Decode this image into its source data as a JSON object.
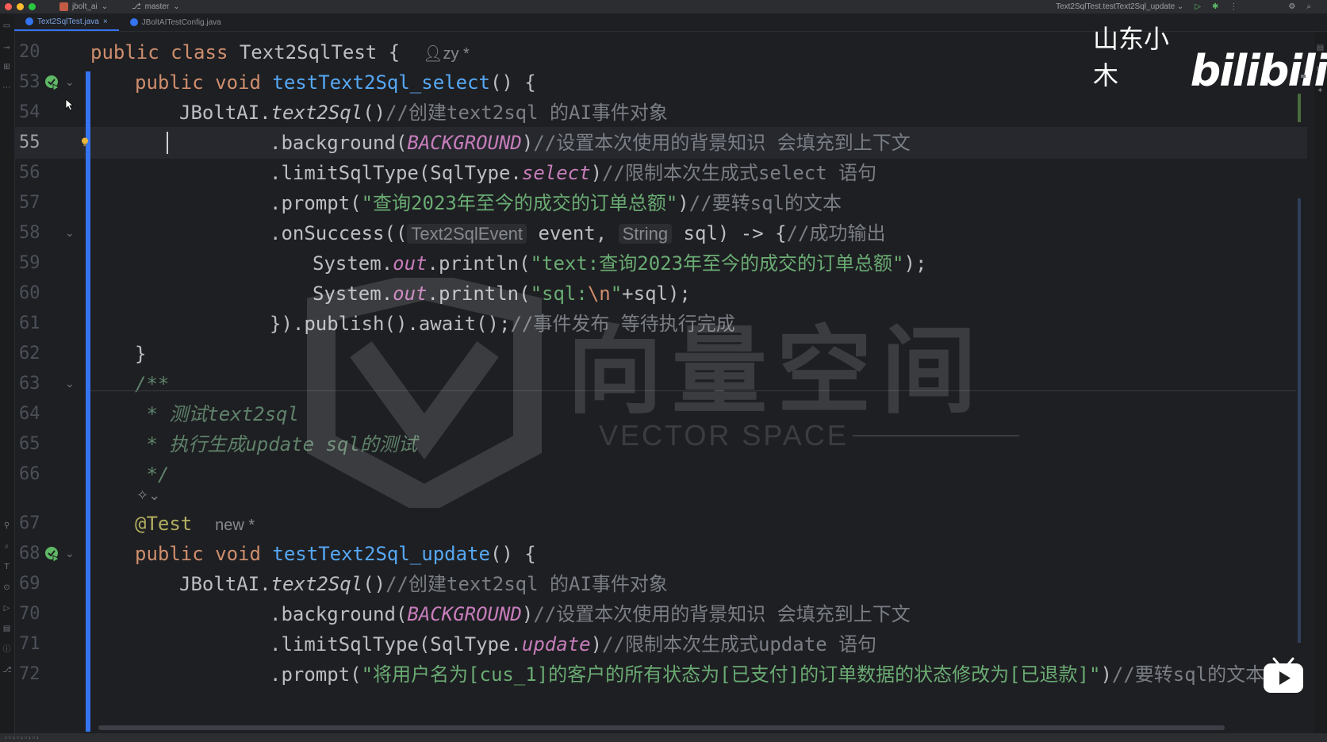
{
  "titlebar": {
    "project": "jbolt_ai",
    "branch": "master",
    "run_config": "Text2SqlTest.testText2Sql_update"
  },
  "tabs": [
    {
      "label": "Text2SqlTest.java",
      "active": true
    },
    {
      "label": "JBoltAITestConfig.java",
      "active": false
    }
  ],
  "watermark": {
    "cn": "向量空间",
    "en": "VECTOR SPACE"
  },
  "overlay": {
    "channel_name": "山东小木",
    "site_logo": "bilibili"
  },
  "code": {
    "lines": [
      {
        "no": "20"
      },
      {
        "no": "53"
      },
      {
        "no": "54"
      },
      {
        "no": "55"
      },
      {
        "no": "56"
      },
      {
        "no": "57"
      },
      {
        "no": "58"
      },
      {
        "no": "59"
      },
      {
        "no": "60"
      },
      {
        "no": "61"
      },
      {
        "no": "62"
      },
      {
        "no": "63"
      },
      {
        "no": "64"
      },
      {
        "no": "65"
      },
      {
        "no": "66"
      },
      {
        "no": ""
      },
      {
        "no": "67"
      },
      {
        "no": "68"
      },
      {
        "no": "69"
      },
      {
        "no": "70"
      },
      {
        "no": "71"
      },
      {
        "no": "72"
      }
    ],
    "l20": {
      "kw1": "public",
      "kw2": "class",
      "name": "Text2SqlTest",
      "brace": "{",
      "author": "zy *"
    },
    "l53": {
      "kw1": "public",
      "kw2": "void",
      "method": "testText2Sql_select",
      "rest": "() {"
    },
    "l54": {
      "obj": "JBoltAI.",
      "call": "text2Sql",
      "paren": "()",
      "cmt": "//创建text2sql 的AI事件对象"
    },
    "l55": {
      "pre": ".background(",
      "cst": "BACKGROUND",
      "post": ")",
      "cmt": "//设置本次使用的背景知识 会填充到上下文"
    },
    "l56": {
      "pre": ".limitSqlType(SqlType.",
      "cst": "select",
      "post": ")",
      "cmt": "//限制本次生成式select 语句"
    },
    "l57": {
      "pre": ".prompt(",
      "str": "\"查询2023年至今的成交的订单总额\"",
      "post": ")",
      "cmt": "//要转sql的文本"
    },
    "l58": {
      "pre": ".onSuccess((",
      "hint1": "Text2SqlEvent",
      "p1": " event, ",
      "hint2": "String",
      "p2": " sql) -> {",
      "cmt": "//成功输出"
    },
    "l59": {
      "pre": "System.",
      "out": "out",
      "mid": ".println(",
      "str": "\"text:查询2023年至今的成交的订单总额\"",
      "post": ");"
    },
    "l60": {
      "pre": "System.",
      "out": "out",
      "mid": ".println(",
      "str1": "\"sql:",
      "esc": "\\n",
      "str2": "\"",
      "post": "+sql);"
    },
    "l61": {
      "pre": "}).publish().await();",
      "cmt": "//事件发布 等待执行完成"
    },
    "l62": {
      "text": "}"
    },
    "l63": {
      "text": "/**"
    },
    "l64": {
      "text": " * 测试text2sql"
    },
    "l65": {
      "text": " * 执行生成update sql的测试"
    },
    "l66": {
      "text": " */"
    },
    "l67": {
      "ann": "@Test",
      "author": "new *"
    },
    "l68": {
      "kw1": "public",
      "kw2": "void",
      "method": "testText2Sql_update",
      "rest": "() {"
    },
    "l69": {
      "obj": "JBoltAI.",
      "call": "text2Sql",
      "paren": "()",
      "cmt": "//创建text2sql 的AI事件对象"
    },
    "l70": {
      "pre": ".background(",
      "cst": "BACKGROUND",
      "post": ")",
      "cmt": "//设置本次使用的背景知识 会填充到上下文"
    },
    "l71": {
      "pre": ".limitSqlType(SqlType.",
      "cst": "update",
      "post": ")",
      "cmt": "//限制本次生成式update 语句"
    },
    "l72": {
      "pre": ".prompt(",
      "str": "\"将用户名为[cus_1]的客户的所有状态为[已支付]的订单数据的状态修改为[已退款]\"",
      "post": ")",
      "cmt": "//要转sql的文本"
    }
  },
  "colors": {
    "background": "#1e1f22",
    "keyword": "#cf8e6d",
    "method": "#56a8f5",
    "string": "#6aab73",
    "constant": "#c77dbb",
    "comment": "#7a7e85",
    "doc_comment": "#5f826b",
    "annotation": "#b3ae60",
    "accent": "#3574f0"
  },
  "icons": [
    "run-test-icon",
    "bulb-icon",
    "fold-icon",
    "user-icon",
    "play-icon"
  ]
}
